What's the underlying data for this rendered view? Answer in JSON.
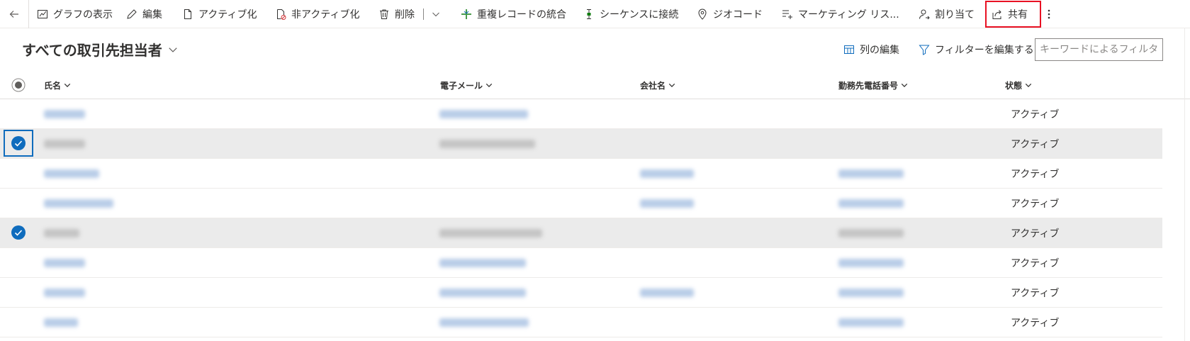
{
  "toolbar": {
    "back_icon": "back-arrow-icon",
    "buttons": [
      {
        "label": "グラフの表示",
        "icon": "chart-icon"
      },
      {
        "label": "編集",
        "icon": "pencil-icon"
      },
      {
        "label": "アクティブ化",
        "icon": "document-icon"
      },
      {
        "label": "非アクティブ化",
        "icon": "document-blocked-icon"
      },
      {
        "label": "削除",
        "icon": "trash-icon"
      },
      {
        "label": "重複レコードの統合",
        "icon": "merge-icon"
      },
      {
        "label": "シーケンスに接続",
        "icon": "sequence-icon"
      },
      {
        "label": "ジオコード",
        "icon": "location-pin-icon"
      },
      {
        "label": "マーケティング リス...",
        "icon": "list-add-icon"
      },
      {
        "label": "割り当て",
        "icon": "person-assign-icon"
      },
      {
        "label": "共有",
        "icon": "share-icon"
      }
    ],
    "more_icon": "more-vertical-icon",
    "highlight_color": "#e81123"
  },
  "view": {
    "title": "すべての取引先担当者",
    "edit_columns_label": "列の編集",
    "edit_filters_label": "フィルターを編集する",
    "search_placeholder": "キーワードによるフィルタ..."
  },
  "grid": {
    "columns": [
      {
        "label": "氏名"
      },
      {
        "label": "電子メール"
      },
      {
        "label": "会社名"
      },
      {
        "label": "勤務先電話番号"
      },
      {
        "label": "状態"
      }
    ],
    "rows": [
      {
        "selected": false,
        "status": "アクティブ"
      },
      {
        "selected": true,
        "status": "アクティブ"
      },
      {
        "selected": false,
        "status": "アクティブ"
      },
      {
        "selected": false,
        "status": "アクティブ"
      },
      {
        "selected": true,
        "status": "アクティブ"
      },
      {
        "selected": false,
        "status": "アクティブ"
      },
      {
        "selected": false,
        "status": "アクティブ"
      },
      {
        "selected": false,
        "status": "アクティブ"
      }
    ]
  },
  "colors": {
    "accent": "#0f6cbd",
    "selected_row": "#ebebeb"
  }
}
